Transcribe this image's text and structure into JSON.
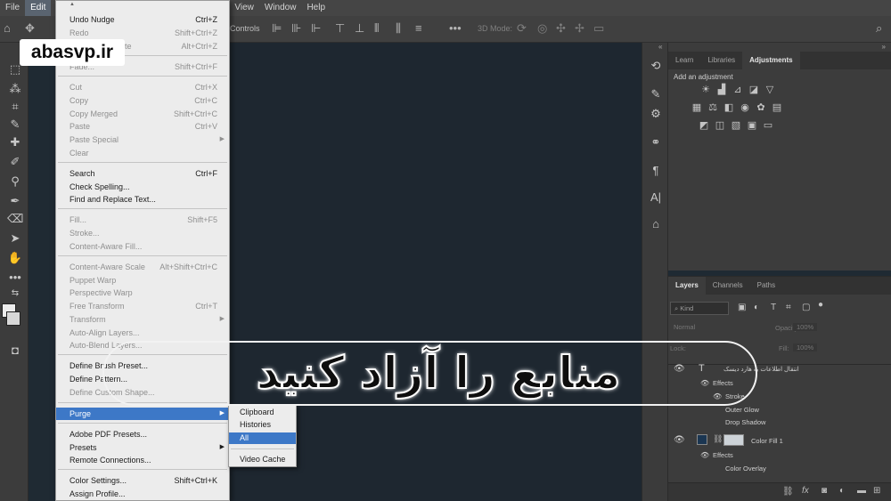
{
  "menubar": [
    "File",
    "Edit",
    "",
    "View",
    "Window",
    "Help"
  ],
  "options_bar": {
    "controls_label": "Controls",
    "mode_label": "3D Mode:"
  },
  "watermark": "abasvp.ir",
  "caption": "منابع را آزاد کنید",
  "edit_menu": [
    {
      "label": "Undo Nudge",
      "shortcut": "Ctrl+Z",
      "enabled": true
    },
    {
      "label": "Redo",
      "shortcut": "Shift+Ctrl+Z",
      "enabled": false
    },
    {
      "label": "Toggle Last State",
      "shortcut": "Alt+Ctrl+Z",
      "enabled": false
    },
    {
      "label": "Fade...",
      "shortcut": "Shift+Ctrl+F",
      "enabled": false
    },
    {
      "label": "Cut",
      "shortcut": "Ctrl+X",
      "enabled": false
    },
    {
      "label": "Copy",
      "shortcut": "Ctrl+C",
      "enabled": false
    },
    {
      "label": "Copy Merged",
      "shortcut": "Shift+Ctrl+C",
      "enabled": false
    },
    {
      "label": "Paste",
      "shortcut": "Ctrl+V",
      "enabled": false
    },
    {
      "label": "Paste Special",
      "shortcut": "",
      "enabled": false,
      "submenu": true
    },
    {
      "label": "Clear",
      "shortcut": "",
      "enabled": false
    },
    {
      "label": "Search",
      "shortcut": "Ctrl+F",
      "enabled": true
    },
    {
      "label": "Check Spelling...",
      "shortcut": "",
      "enabled": true
    },
    {
      "label": "Find and Replace Text...",
      "shortcut": "",
      "enabled": true
    },
    {
      "label": "Fill...",
      "shortcut": "Shift+F5",
      "enabled": false
    },
    {
      "label": "Stroke...",
      "shortcut": "",
      "enabled": false
    },
    {
      "label": "Content-Aware Fill...",
      "shortcut": "",
      "enabled": false
    },
    {
      "label": "Content-Aware Scale",
      "shortcut": "Alt+Shift+Ctrl+C",
      "enabled": false
    },
    {
      "label": "Puppet Warp",
      "shortcut": "",
      "enabled": false
    },
    {
      "label": "Perspective Warp",
      "shortcut": "",
      "enabled": false
    },
    {
      "label": "Free Transform",
      "shortcut": "Ctrl+T",
      "enabled": false
    },
    {
      "label": "Transform",
      "shortcut": "",
      "enabled": false,
      "submenu": true
    },
    {
      "label": "Auto-Align Layers...",
      "shortcut": "",
      "enabled": false
    },
    {
      "label": "Auto-Blend Layers...",
      "shortcut": "",
      "enabled": false
    },
    {
      "label": "Define Brush Preset...",
      "shortcut": "",
      "enabled": true
    },
    {
      "label": "Define Pattern...",
      "shortcut": "",
      "enabled": true
    },
    {
      "label": "Define Custom Shape...",
      "shortcut": "",
      "enabled": false
    },
    {
      "label": "Purge",
      "shortcut": "",
      "enabled": true,
      "submenu": true,
      "highlighted": true
    },
    {
      "label": "Adobe PDF Presets...",
      "shortcut": "",
      "enabled": true
    },
    {
      "label": "Presets",
      "shortcut": "",
      "enabled": true,
      "submenu": true
    },
    {
      "label": "Remote Connections...",
      "shortcut": "",
      "enabled": true
    },
    {
      "label": "Color Settings...",
      "shortcut": "Shift+Ctrl+K",
      "enabled": true
    },
    {
      "label": "Assign Profile...",
      "shortcut": "",
      "enabled": true
    }
  ],
  "purge_submenu": [
    {
      "label": "Clipboard",
      "highlighted": false
    },
    {
      "label": "Histories",
      "highlighted": false
    },
    {
      "label": "All",
      "highlighted": true
    },
    {
      "label": "Video Cache",
      "highlighted": false
    }
  ],
  "top_panel": {
    "tabs": [
      "Learn",
      "Libraries",
      "Adjustments"
    ],
    "active_tab": "Adjustments",
    "add_label": "Add an adjustment"
  },
  "layers_panel": {
    "tabs": [
      "Layers",
      "Channels",
      "Paths"
    ],
    "active_tab": "Layers",
    "filter": "Kind",
    "blend_mode": "Normal",
    "opacity_label": "Opacity:",
    "opacity_value": "100%",
    "lock_label": "Lock:",
    "fill_label": "Fill:",
    "fill_value": "100%",
    "layers": [
      {
        "name": "انتقال اطلاعات به هارد دیسک",
        "kind": "text"
      },
      {
        "name": "Effects",
        "kind": "effects"
      },
      {
        "name": "Stroke",
        "kind": "effect"
      },
      {
        "name": "Outer Glow",
        "kind": "effect"
      },
      {
        "name": "Drop Shadow",
        "kind": "effect"
      },
      {
        "name": "Color Fill 1",
        "kind": "fill"
      },
      {
        "name": "Effects",
        "kind": "effects"
      },
      {
        "name": "Color Overlay",
        "kind": "effect"
      }
    ]
  },
  "colors": {
    "highlight": "#3d78c7",
    "canvas": "#1e2730",
    "menu_bg": "#ececec"
  }
}
